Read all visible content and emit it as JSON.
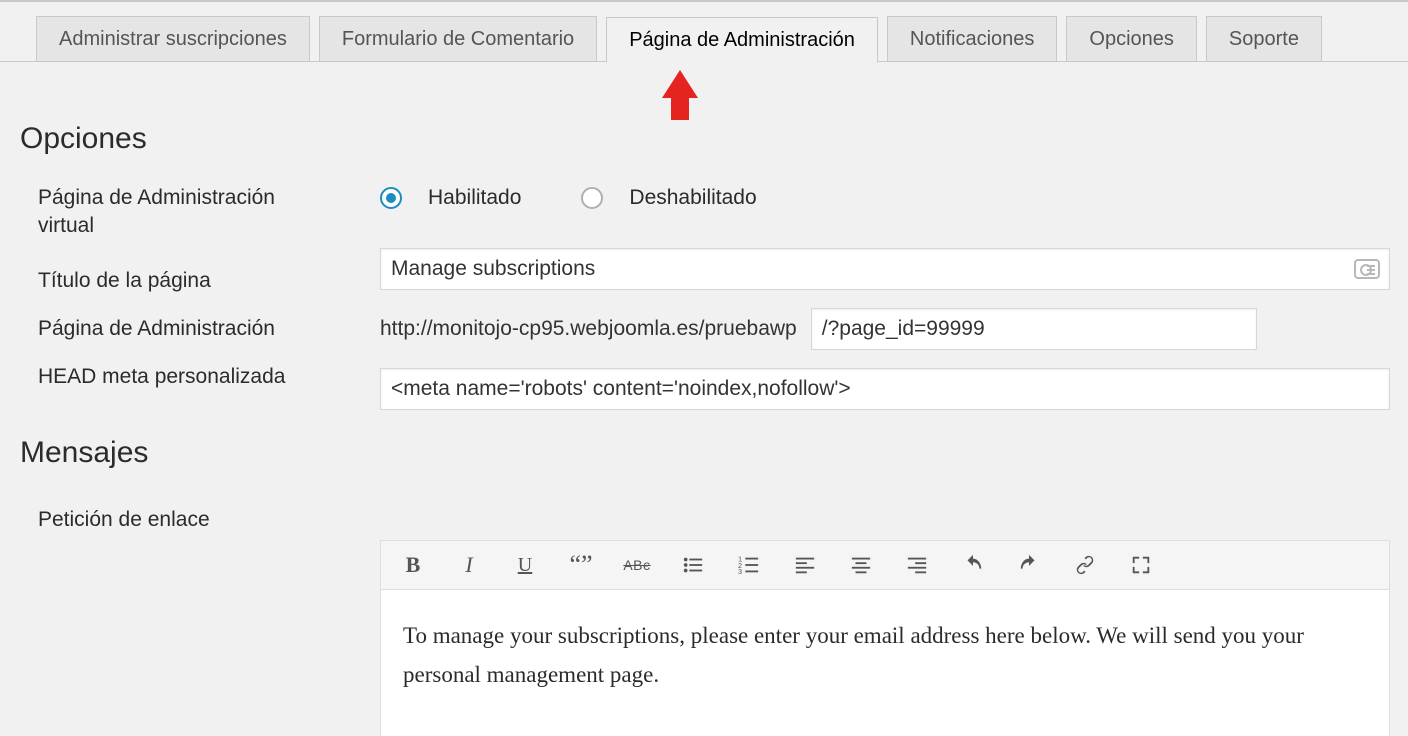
{
  "tabs": {
    "items": [
      {
        "label": "Administrar suscripciones",
        "active": false
      },
      {
        "label": "Formulario de Comentario",
        "active": false
      },
      {
        "label": "Página de Administración",
        "active": true
      },
      {
        "label": "Notificaciones",
        "active": false
      },
      {
        "label": "Opciones",
        "active": false
      },
      {
        "label": "Soporte",
        "active": false
      }
    ]
  },
  "sections": {
    "options_title": "Opciones",
    "messages_title": "Mensajes",
    "labels": {
      "virtual_page": "Página de Administración virtual",
      "page_title": "Título de la página",
      "admin_page": "Página de Administración",
      "head_meta": "HEAD meta personalizada",
      "link_request": "Petición de enlace"
    }
  },
  "form": {
    "virtual_page": {
      "enabled_label": "Habilitado",
      "disabled_label": "Deshabilitado",
      "value": "enabled"
    },
    "page_title_value": "Manage subscriptions",
    "admin_page": {
      "url_prefix": "http://monitojo-cp95.webjoomla.es/pruebawp",
      "path_value": "/?page_id=99999"
    },
    "head_meta_value": "<meta name='robots' content='noindex,nofollow'>"
  },
  "editor": {
    "toolbar": [
      "bold",
      "italic",
      "underline",
      "blockquote",
      "strikethrough",
      "bullet-list",
      "numbered-list",
      "align-left",
      "align-center",
      "align-right",
      "undo",
      "redo",
      "link",
      "fullscreen"
    ],
    "content": "To manage your subscriptions, please enter your email address here below. We will send you your personal management page."
  }
}
